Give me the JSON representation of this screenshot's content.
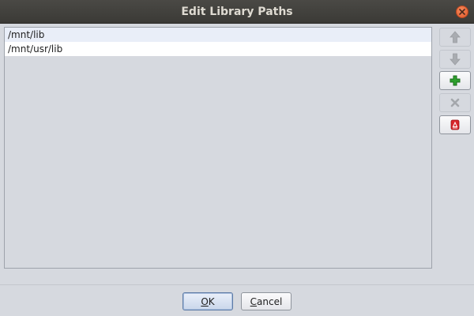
{
  "window": {
    "title": "Edit Library Paths",
    "close_icon": "close-icon"
  },
  "paths": [
    {
      "value": "/mnt/lib"
    },
    {
      "value": "/mnt/usr/lib"
    }
  ],
  "side_buttons": {
    "move_up": {
      "icon": "arrow-up-icon",
      "enabled": false
    },
    "move_down": {
      "icon": "arrow-down-icon",
      "enabled": false
    },
    "add": {
      "icon": "plus-icon",
      "enabled": true,
      "color": "#2da02d"
    },
    "remove": {
      "icon": "x-icon",
      "enabled": false
    },
    "clear": {
      "icon": "eraser-icon",
      "enabled": true,
      "color": "#d8262b"
    }
  },
  "buttons": {
    "ok": {
      "mnemonic": "O",
      "rest": "K"
    },
    "cancel": {
      "mnemonic": "C",
      "rest": "ancel"
    }
  },
  "colors": {
    "titlebar": "#3e3d39",
    "close": "#e9602e",
    "background": "#d6d9df",
    "selected_row": "#e9eef8"
  }
}
